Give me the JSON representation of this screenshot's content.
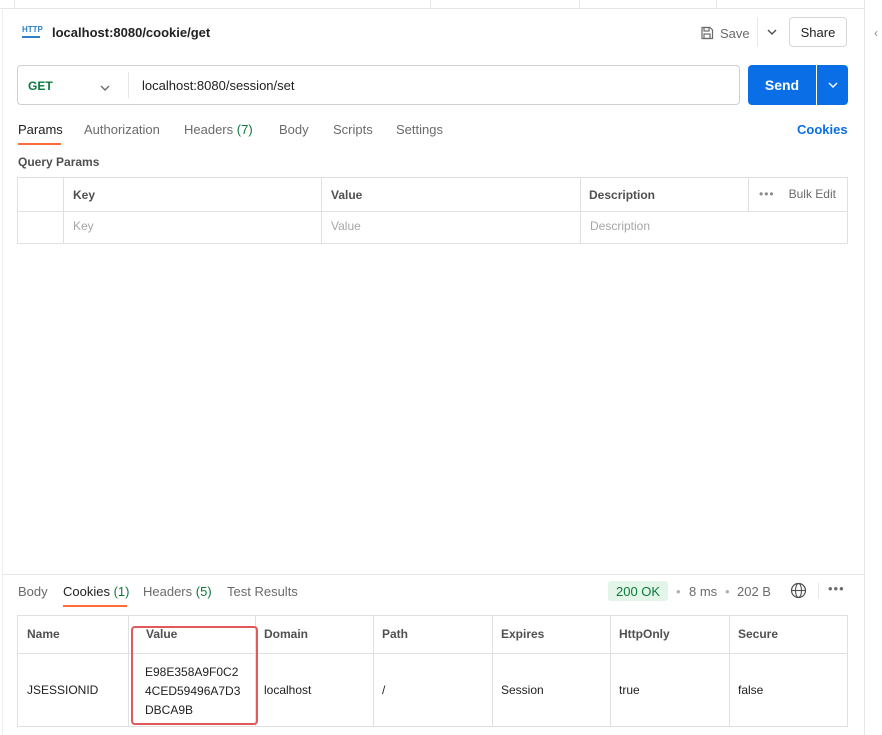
{
  "request": {
    "title": "localhost:8080/cookie/get",
    "method": "GET",
    "url": "localhost:8080/session/set"
  },
  "toolbar": {
    "save_label": "Save",
    "share_label": "Share",
    "send_label": "Send"
  },
  "request_tabs": [
    {
      "label": "Params",
      "count": ""
    },
    {
      "label": "Authorization",
      "count": ""
    },
    {
      "label": "Headers",
      "count": "(7)"
    },
    {
      "label": "Body",
      "count": ""
    },
    {
      "label": "Scripts",
      "count": ""
    },
    {
      "label": "Settings",
      "count": ""
    }
  ],
  "cookies_link": "Cookies",
  "query_params": {
    "label": "Query Params",
    "headers": [
      "Key",
      "Value",
      "Description"
    ],
    "bulk_edit": "Bulk Edit",
    "placeholders": [
      "Key",
      "Value",
      "Description"
    ]
  },
  "response": {
    "tabs": [
      {
        "label": "Body",
        "count": ""
      },
      {
        "label": "Cookies",
        "count": "(1)"
      },
      {
        "label": "Headers",
        "count": "(5)"
      },
      {
        "label": "Test Results",
        "count": ""
      }
    ],
    "status": "200 OK",
    "time": "8 ms",
    "size": "202 B",
    "cookie_table": {
      "headers": [
        "Name",
        "Value",
        "Domain",
        "Path",
        "Expires",
        "HttpOnly",
        "Secure"
      ],
      "rows": [
        {
          "name": "JSESSIONID",
          "value": "E98E358A9F0C24CED59496A7D3DBCA9B",
          "domain": "localhost",
          "path": "/",
          "expires": "Session",
          "httponly": "true",
          "secure": "false"
        }
      ]
    }
  },
  "colors": {
    "accent": "#0a6fe6",
    "tab_underline": "#ff6c37",
    "success": "#0b7a3b",
    "highlight_box": "#e05a5a"
  },
  "icons": [
    "http-icon",
    "save-icon",
    "chevron-down-icon",
    "more-icon",
    "globe-icon",
    "collapse-icon"
  ]
}
